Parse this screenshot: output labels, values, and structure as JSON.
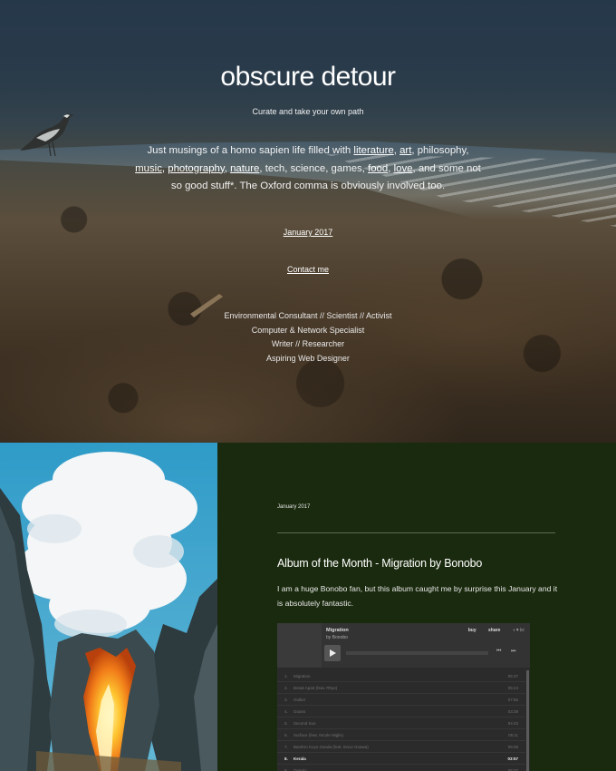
{
  "hero": {
    "title": "obscure detour",
    "tagline": "Curate and take your own path",
    "intro": {
      "t1": "Just musings of a homo sapien life filled with ",
      "literature": "literature",
      "c1": ", ",
      "art": "art",
      "t2": ", philosophy, ",
      "music": "music",
      "c2": ",",
      "photography": "photography",
      "c3": ", ",
      "nature": "nature",
      "t3": ", tech, science, games, ",
      "food": "food",
      "c4": ", ",
      "love": "love",
      "t4": ", and some not so good stuff*. The Oxford comma is obviously involved too."
    },
    "archive_link": "January 2017",
    "contact_link": "Contact me",
    "roles": [
      "Environmental Consultant // Scientist // Activist",
      "Computer & Network Specialist",
      "Writer // Researcher",
      "Aspiring Web Designer"
    ]
  },
  "post": {
    "date": "January 2017",
    "title": "Album of the Month - Migration by Bonobo",
    "body": "I am a huge Bonobo fan, but this album caught me by surprise this January and it is absolutely fantastic."
  },
  "player": {
    "album": "Migration",
    "artist": "by Bonobo",
    "buy": "buy",
    "share": "share",
    "brand": "◖▼bc",
    "prev": "⏮",
    "next": "⏭",
    "progress": 0.0,
    "tracks": [
      {
        "num": "1.",
        "name": "Migration",
        "duration": "05:37"
      },
      {
        "num": "2.",
        "name": "Break Apart (feat. Rhye)",
        "duration": "05:24"
      },
      {
        "num": "3.",
        "name": "Outlier",
        "duration": "07:56"
      },
      {
        "num": "4.",
        "name": "Grains",
        "duration": "03:38"
      },
      {
        "num": "5.",
        "name": "Second Sun",
        "duration": "04:43"
      },
      {
        "num": "6.",
        "name": "Surface (feat. Nicole Miglis)",
        "duration": "05:11"
      },
      {
        "num": "7.",
        "name": "Bambro Koyo Ganda (feat. Innov Gnawa)",
        "duration": "05:09"
      },
      {
        "num": "8.",
        "name": "Kerala",
        "duration": "03:57",
        "active": true
      },
      {
        "num": "9.",
        "name": "Ontario",
        "duration": "05:07"
      }
    ]
  }
}
